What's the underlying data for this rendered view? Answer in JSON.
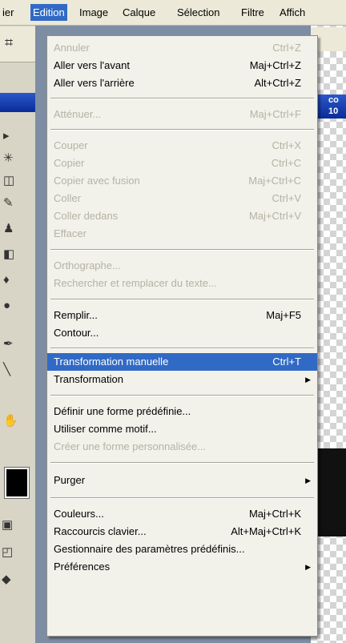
{
  "menubar": {
    "items": [
      {
        "label": "ier"
      },
      {
        "label": "Edition"
      },
      {
        "label": "Image"
      },
      {
        "label": "Calque"
      },
      {
        "label": "Sélection"
      },
      {
        "label": "Filtre"
      },
      {
        "label": "Affich"
      }
    ],
    "active_index": 1
  },
  "edition_menu": {
    "annuler": {
      "label": "Annuler",
      "shortcut": "Ctrl+Z",
      "enabled": false
    },
    "aller_avant": {
      "label": "Aller vers l'avant",
      "shortcut": "Maj+Ctrl+Z",
      "enabled": true
    },
    "aller_arriere": {
      "label": "Aller vers l'arrière",
      "shortcut": "Alt+Ctrl+Z",
      "enabled": true
    },
    "attenuer": {
      "label": "Atténuer...",
      "shortcut": "Maj+Ctrl+F",
      "enabled": false
    },
    "couper": {
      "label": "Couper",
      "shortcut": "Ctrl+X",
      "enabled": false
    },
    "copier": {
      "label": "Copier",
      "shortcut": "Ctrl+C",
      "enabled": false
    },
    "copier_fusion": {
      "label": "Copier avec fusion",
      "shortcut": "Maj+Ctrl+C",
      "enabled": false
    },
    "coller": {
      "label": "Coller",
      "shortcut": "Ctrl+V",
      "enabled": false
    },
    "coller_dedans": {
      "label": "Coller dedans",
      "shortcut": "Maj+Ctrl+V",
      "enabled": false
    },
    "effacer": {
      "label": "Effacer",
      "enabled": false
    },
    "orthographe": {
      "label": "Orthographe...",
      "enabled": false
    },
    "rechercher": {
      "label": "Rechercher et remplacer du texte...",
      "enabled": false
    },
    "remplir": {
      "label": "Remplir...",
      "shortcut": "Maj+F5",
      "enabled": true
    },
    "contour": {
      "label": "Contour...",
      "enabled": true
    },
    "transformation_manuelle": {
      "label": "Transformation manuelle",
      "shortcut": "Ctrl+T",
      "enabled": true,
      "highlighted": true
    },
    "transformation": {
      "label": "Transformation",
      "submenu": true,
      "enabled": true
    },
    "definir_forme": {
      "label": "Définir une forme prédéfinie...",
      "enabled": true
    },
    "utiliser_motif": {
      "label": "Utiliser comme motif...",
      "enabled": true
    },
    "creer_forme": {
      "label": "Créer une forme personnalisée...",
      "enabled": false
    },
    "purger": {
      "label": "Purger",
      "submenu": true,
      "enabled": true
    },
    "couleurs": {
      "label": "Couleurs...",
      "shortcut": "Maj+Ctrl+K",
      "enabled": true
    },
    "raccourcis": {
      "label": "Raccourcis clavier...",
      "shortcut": "Alt+Maj+Ctrl+K",
      "enabled": true
    },
    "gestionnaire": {
      "label": "Gestionnaire des paramètres prédéfinis...",
      "enabled": true
    },
    "preferences": {
      "label": "Préférences",
      "submenu": true,
      "enabled": true
    }
  },
  "right_panel": {
    "title_fragment": "co",
    "number_fragment": "10"
  },
  "colors": {
    "highlight": "#316ac5",
    "menu_bg": "#f2f1ea",
    "disabled_text": "#b6b3a4"
  },
  "icons": [
    "arrow-submenu-icon",
    "crop-tool-icon",
    "move-tool-icon",
    "lasso-tool-icon",
    "brush-tool-icon",
    "eraser-tool-icon",
    "pen-tool-icon",
    "hand-tool-icon",
    "zoom-tool-icon"
  ]
}
